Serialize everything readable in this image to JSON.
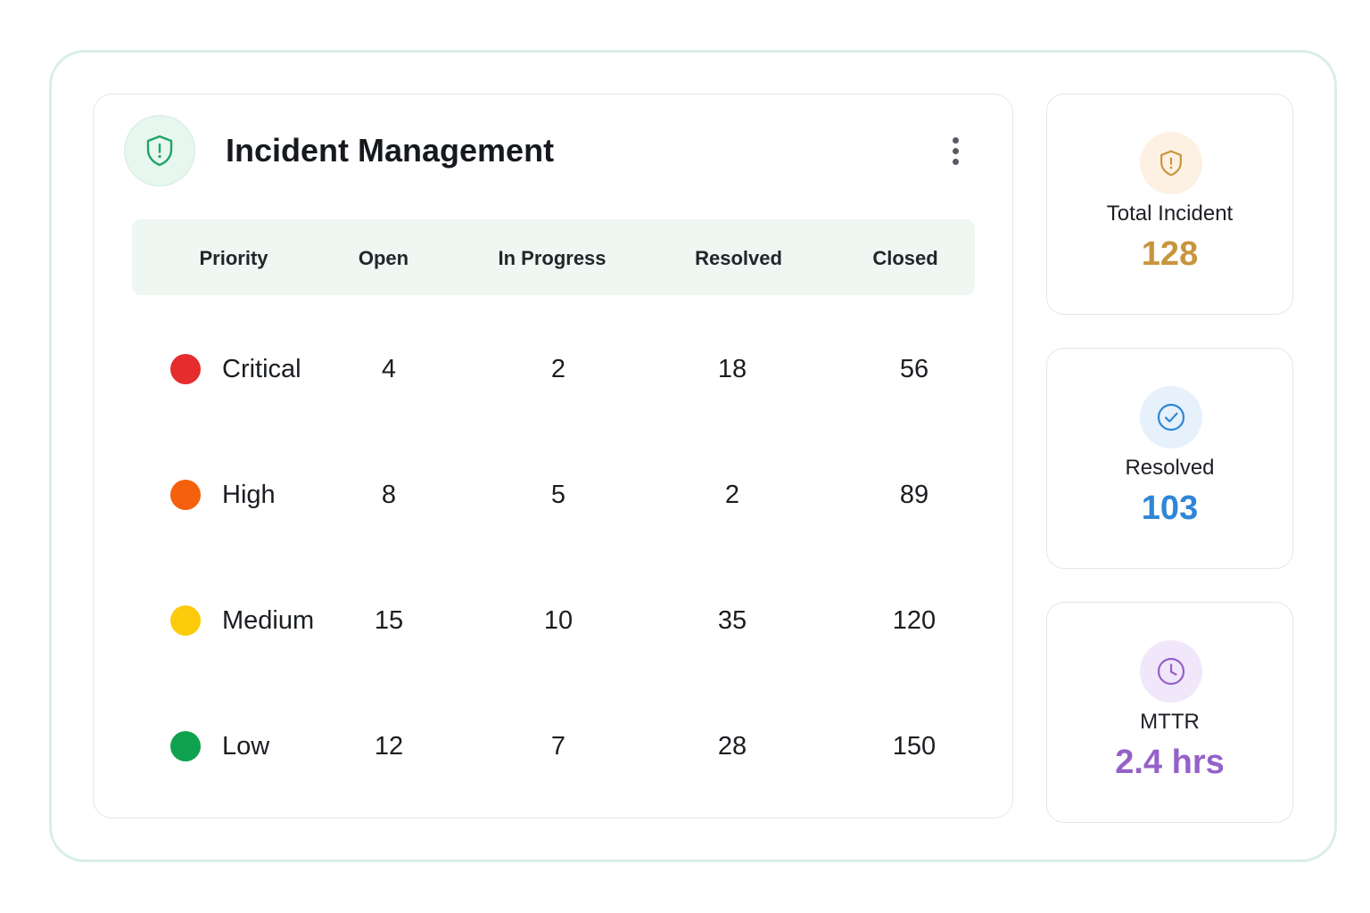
{
  "header": {
    "title": "Incident Management",
    "icon": "shield-alert-icon",
    "more_icon": "more-vertical-icon"
  },
  "table": {
    "columns": [
      "Priority",
      "Open",
      "In Progress",
      "Resolved",
      "Closed"
    ],
    "rows": [
      {
        "priority": "Critical",
        "color": "#e52d2d",
        "open": "4",
        "in_progress": "2",
        "resolved": "18",
        "closed": "56"
      },
      {
        "priority": "High",
        "color": "#f5600c",
        "open": "8",
        "in_progress": "5",
        "resolved": "2",
        "closed": "89"
      },
      {
        "priority": "Medium",
        "color": "#fdcb0b",
        "open": "15",
        "in_progress": "10",
        "resolved": "35",
        "closed": "120"
      },
      {
        "priority": "Low",
        "color": "#0fa24e",
        "open": "12",
        "in_progress": "7",
        "resolved": "28",
        "closed": "150"
      }
    ]
  },
  "stats": [
    {
      "label": "Total Incident",
      "value": "128",
      "icon": "shield-alert-icon",
      "color": "#c8953d",
      "icon_bg": "#fdf1e3"
    },
    {
      "label": "Resolved",
      "value": "103",
      "icon": "check-circle-icon",
      "color": "#2f86d6",
      "icon_bg": "#e6f1fc"
    },
    {
      "label": "MTTR",
      "value": "2.4 hrs",
      "icon": "clock-icon",
      "color": "#9561c9",
      "icon_bg": "#f1e7fb"
    }
  ]
}
